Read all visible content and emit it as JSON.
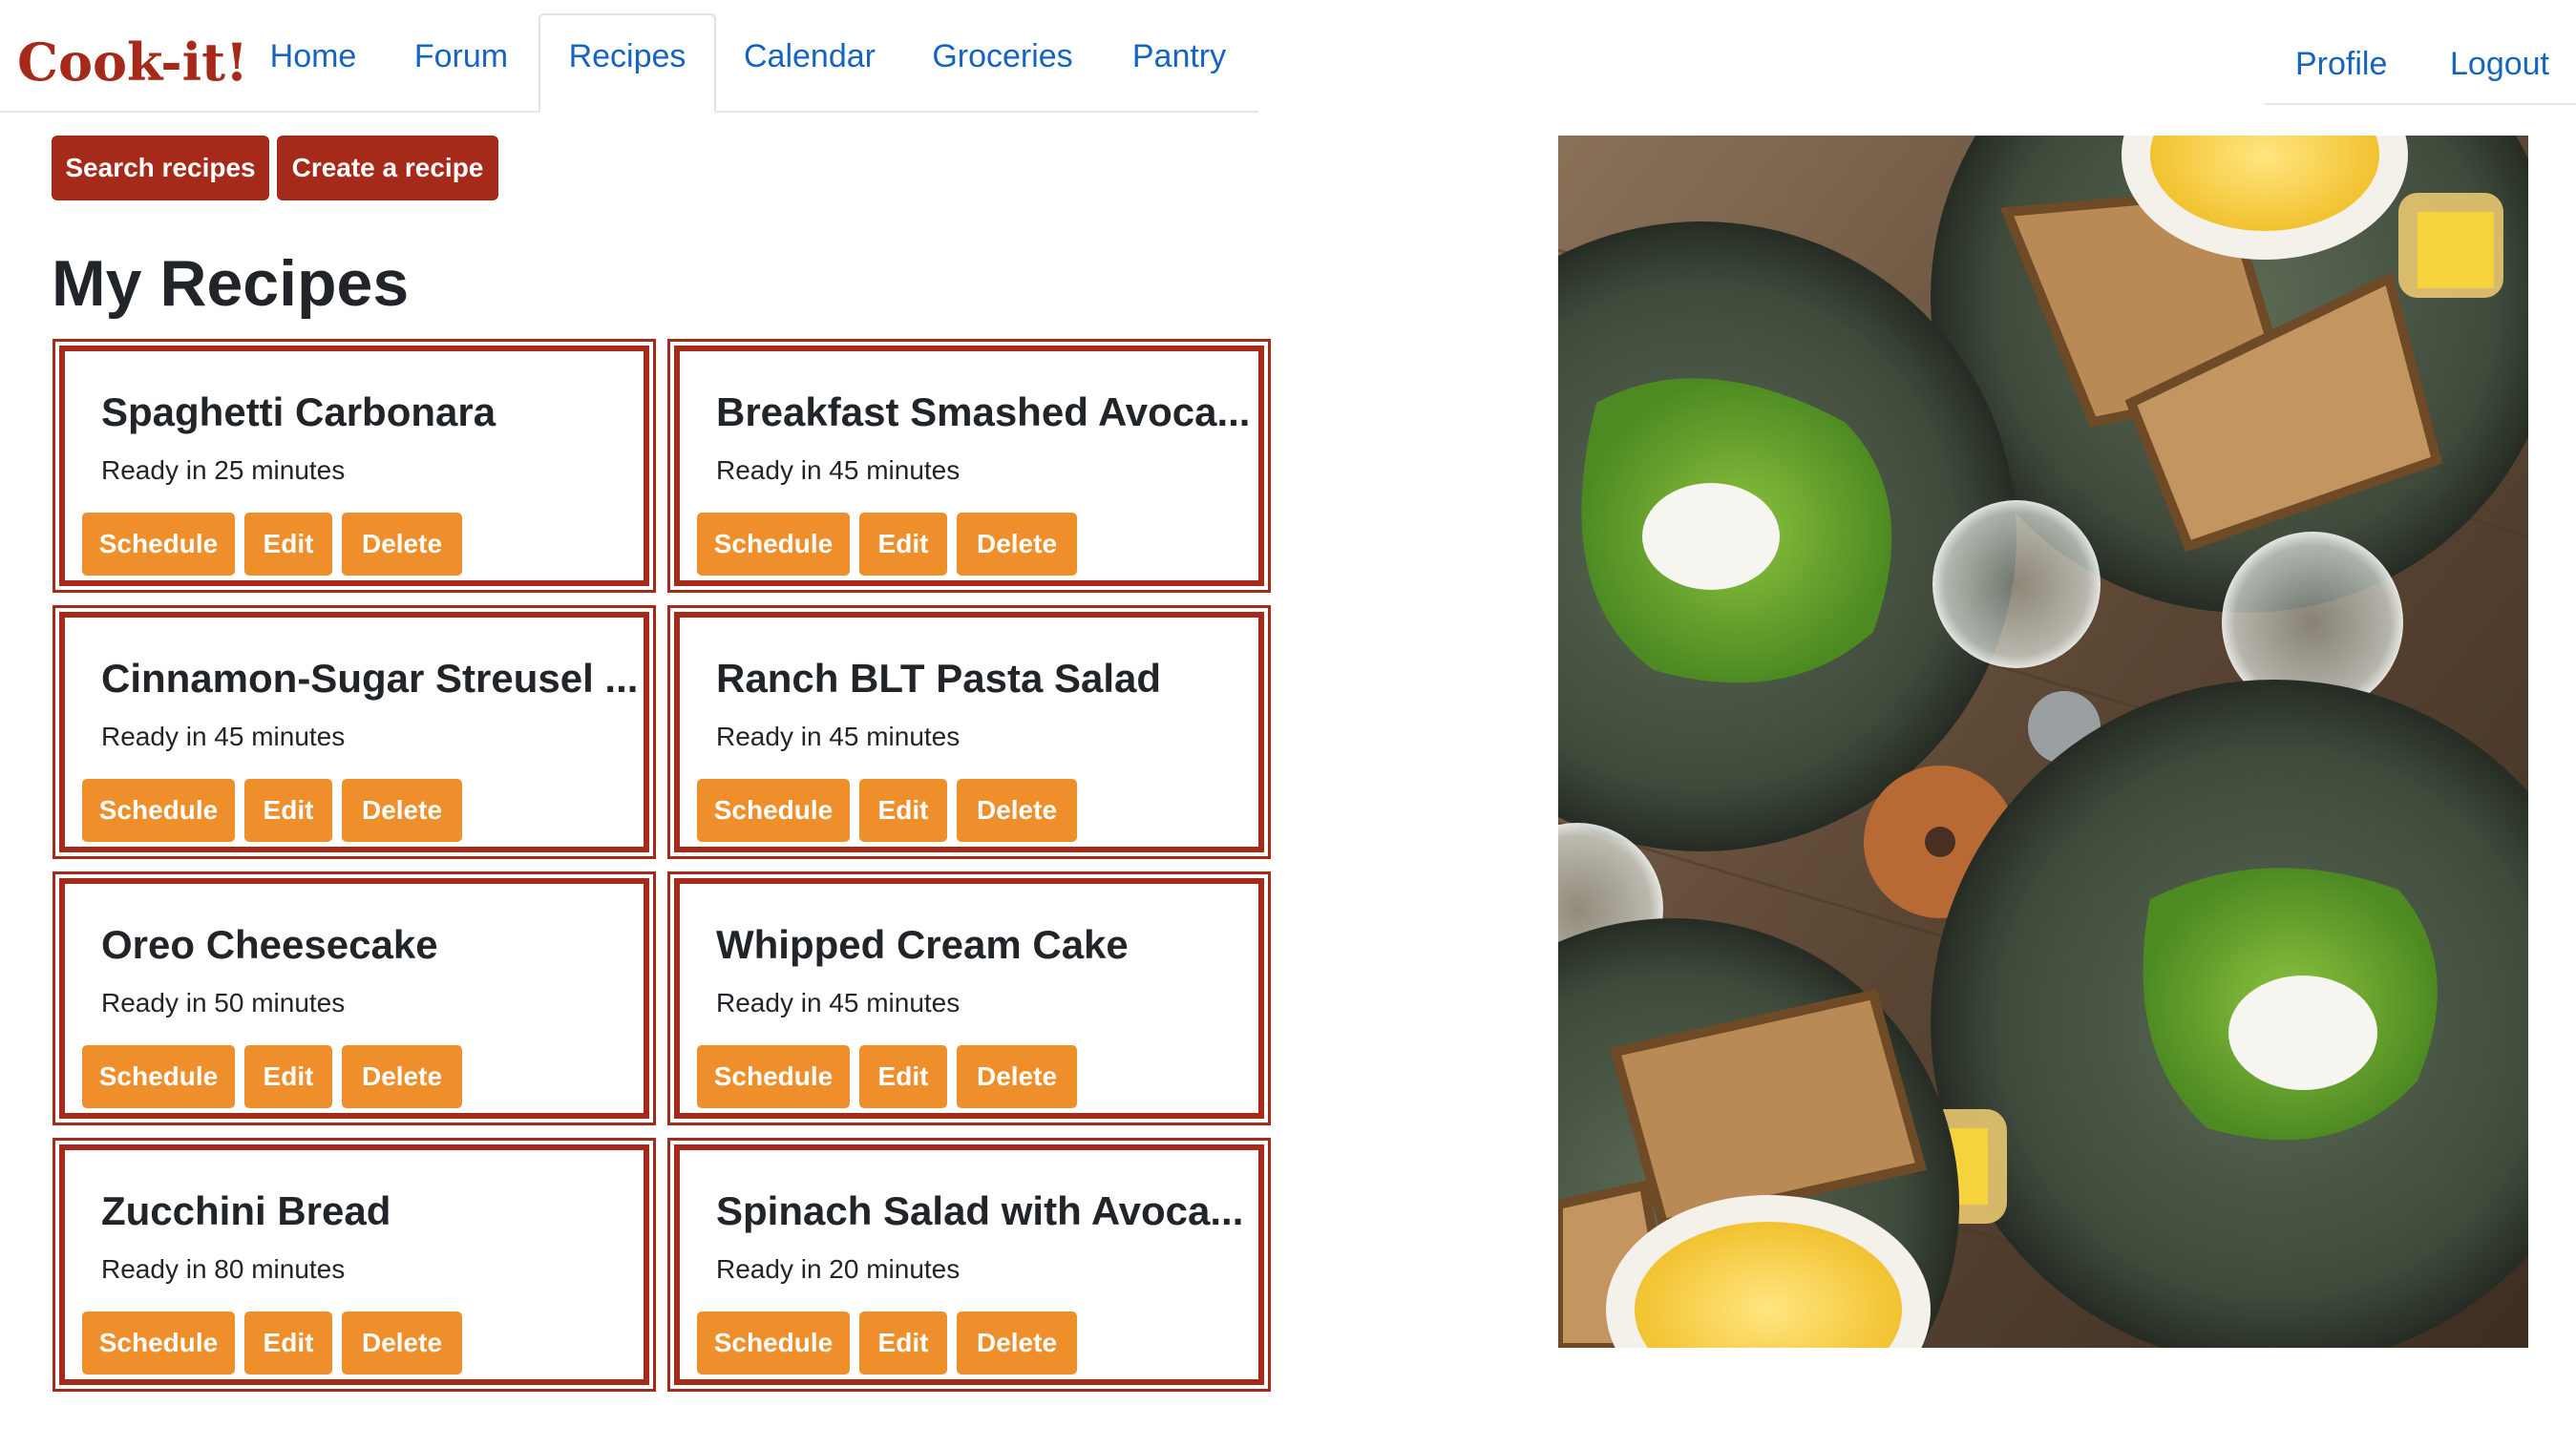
{
  "app": {
    "brand": "Cook-it!"
  },
  "nav": {
    "items": [
      "Home",
      "Forum",
      "Recipes",
      "Calendar",
      "Groceries",
      "Pantry"
    ],
    "active": "Recipes"
  },
  "user_nav": {
    "profile": "Profile",
    "logout": "Logout"
  },
  "actions": {
    "search": "Search recipes",
    "create": "Create a recipe"
  },
  "page": {
    "title": "My Recipes"
  },
  "card_buttons": {
    "schedule": "Schedule",
    "edit": "Edit",
    "delete": "Delete"
  },
  "recipes": [
    {
      "title": "Spaghetti Carbonara",
      "ready": "Ready in 25 minutes"
    },
    {
      "title": "Breakfast Smashed Avoca...",
      "ready": "Ready in 45 minutes"
    },
    {
      "title": "Cinnamon-Sugar Streusel ...",
      "ready": "Ready in 45 minutes"
    },
    {
      "title": "Ranch BLT Pasta Salad",
      "ready": "Ready in 45 minutes"
    },
    {
      "title": "Oreo Cheesecake",
      "ready": "Ready in 50 minutes"
    },
    {
      "title": "Whipped Cream Cake",
      "ready": "Ready in 45 minutes"
    },
    {
      "title": "Zucchini Bread",
      "ready": "Ready in 80 minutes"
    },
    {
      "title": "Spinach Salad with Avoca...",
      "ready": "Ready in 20 minutes"
    }
  ],
  "colors": {
    "brand": "#a52a1a",
    "link": "#1565c0",
    "accent": "#ef8f2c"
  },
  "hero_image": {
    "description": "overhead food photo",
    "icon": "photo-image"
  }
}
